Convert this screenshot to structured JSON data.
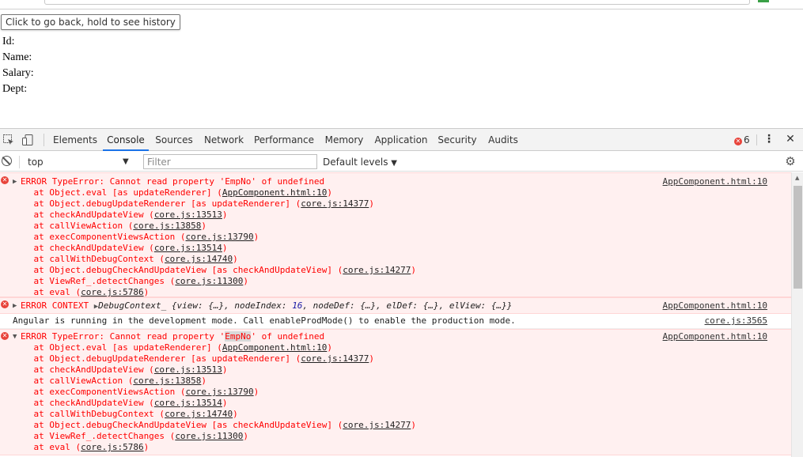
{
  "page": {
    "back_button": "Click to go back, hold to see history",
    "fields": [
      "Id:",
      "Name:",
      "Salary:",
      "Dept:"
    ]
  },
  "devtools": {
    "tabs": [
      "Elements",
      "Console",
      "Sources",
      "Network",
      "Performance",
      "Memory",
      "Application",
      "Security",
      "Audits"
    ],
    "active_tab": "Console",
    "error_count": "6",
    "context": "top",
    "filter_placeholder": "Filter",
    "levels": "Default levels"
  },
  "console": {
    "error1": {
      "header": "ERROR TypeError: Cannot read property 'EmpNo' of undefined",
      "source": "AppComponent.html:10",
      "stack": [
        {
          "pre": "    at Object.eval [as updateRenderer] (",
          "link": "AppComponent.html:10",
          "post": ")"
        },
        {
          "pre": "    at Object.debugUpdateRenderer [as updateRenderer] (",
          "link": "core.js:14377",
          "post": ")"
        },
        {
          "pre": "    at checkAndUpdateView (",
          "link": "core.js:13513",
          "post": ")"
        },
        {
          "pre": "    at callViewAction (",
          "link": "core.js:13858",
          "post": ")"
        },
        {
          "pre": "    at execComponentViewsAction (",
          "link": "core.js:13790",
          "post": ")"
        },
        {
          "pre": "    at checkAndUpdateView (",
          "link": "core.js:13514",
          "post": ")"
        },
        {
          "pre": "    at callWithDebugContext (",
          "link": "core.js:14740",
          "post": ")"
        },
        {
          "pre": "    at Object.debugCheckAndUpdateView [as checkAndUpdateView] (",
          "link": "core.js:14277",
          "post": ")"
        },
        {
          "pre": "    at ViewRef_.detectChanges (",
          "link": "core.js:11300",
          "post": ")"
        },
        {
          "pre": "    at eval (",
          "link": "core.js:5786",
          "post": ")"
        }
      ]
    },
    "context_error": {
      "prefix": "ERROR CONTEXT ",
      "object_name": "DebugContext_",
      "object_body_1": " {view: {…}, nodeIndex: ",
      "node_index": "16",
      "object_body_2": ", nodeDef: {…}, elDef: {…}, elView: {…}}",
      "source": "AppComponent.html:10"
    },
    "info": {
      "text": "Angular is running in the development mode. Call enableProdMode() to enable the production mode.",
      "source": "core.js:3565"
    },
    "error2": {
      "header_pre": "ERROR TypeError: Cannot read property '",
      "header_hl": "EmpNo",
      "header_post": "' of undefined",
      "source": "AppComponent.html:10"
    }
  }
}
